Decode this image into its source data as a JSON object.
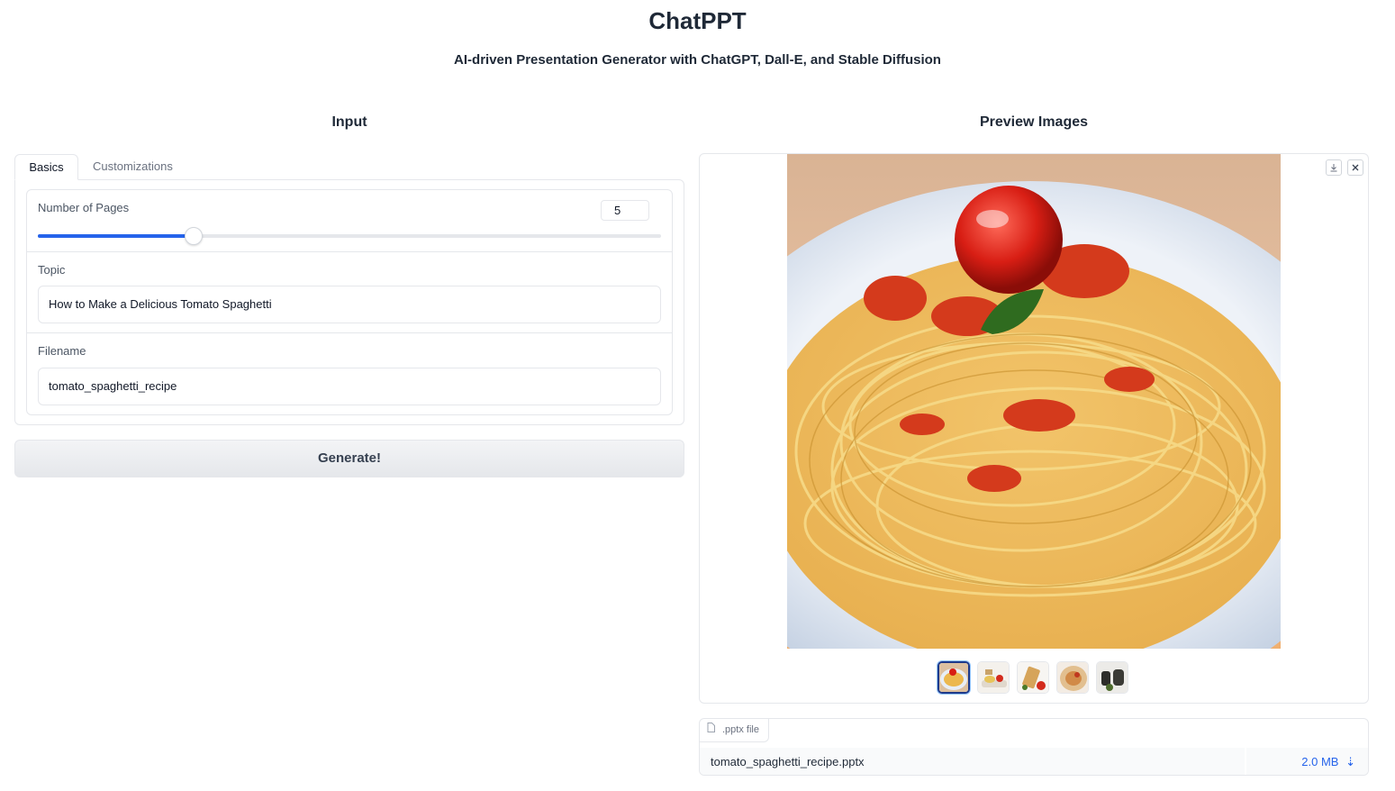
{
  "header": {
    "title": "ChatPPT",
    "subtitle": "AI-driven Presentation Generator with ChatGPT, Dall-E, and Stable Diffusion"
  },
  "input_panel": {
    "heading": "Input",
    "tabs": [
      {
        "label": "Basics",
        "active": true
      },
      {
        "label": "Customizations",
        "active": false
      }
    ],
    "pages": {
      "label": "Number of Pages",
      "value": "5",
      "slider_fraction": 0.25
    },
    "topic": {
      "label": "Topic",
      "value": "How to Make a Delicious Tomato Spaghetti"
    },
    "filename": {
      "label": "Filename",
      "value": "tomato_spaghetti_recipe"
    },
    "generate_label": "Generate!"
  },
  "preview_panel": {
    "heading": "Preview Images",
    "download_icon": "download-icon",
    "close_icon": "close-icon",
    "thumbnail_count": 5,
    "selected_thumbnail": 0
  },
  "file_output": {
    "label": ".pptx file",
    "file_name": "tomato_spaghetti_recipe.pptx",
    "file_size": "2.0 MB"
  },
  "colors": {
    "accent": "#2563eb",
    "border": "#e5e7eb"
  }
}
